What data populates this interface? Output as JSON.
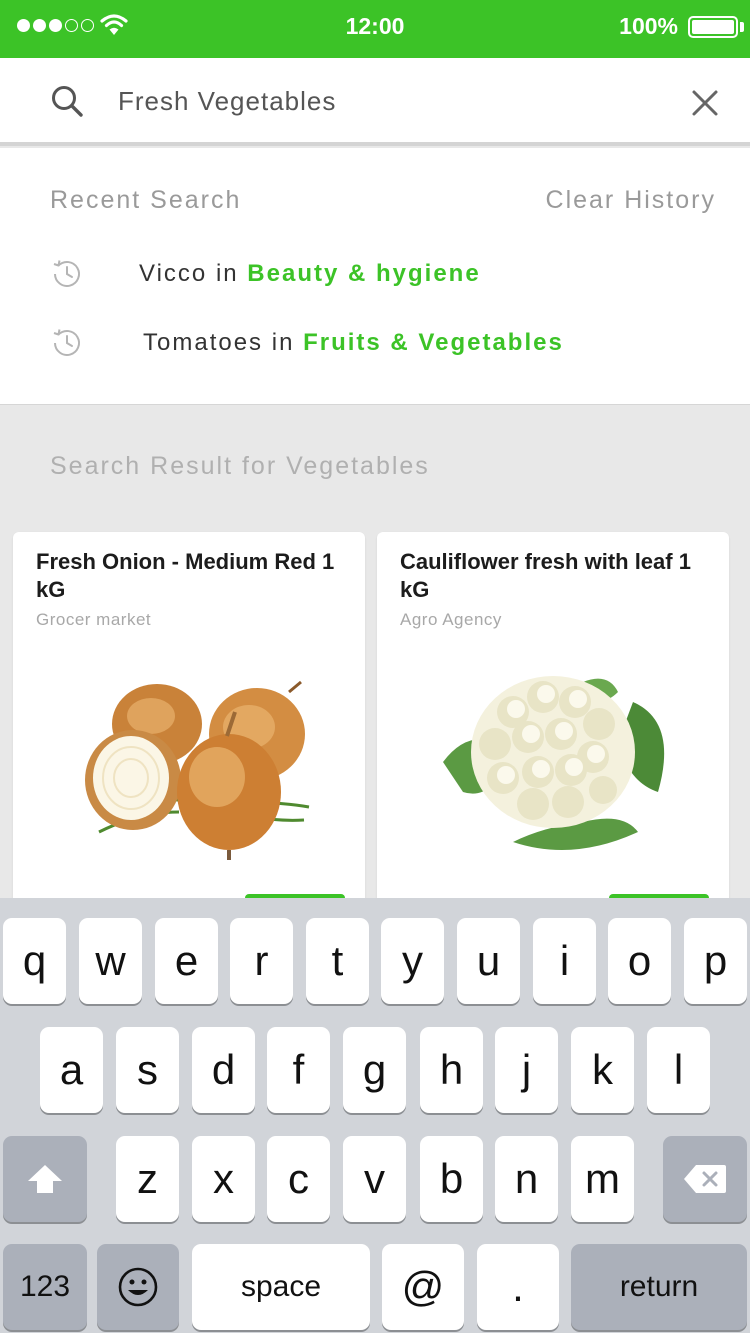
{
  "status_bar": {
    "time": "12:00",
    "battery": "100%",
    "signal_bars_filled": 3,
    "signal_bars_total": 5
  },
  "search": {
    "value": "Fresh Vegetables",
    "placeholder": ""
  },
  "recent": {
    "title": "Recent Search",
    "clear_label": "Clear History",
    "items": [
      {
        "term": "Vicco",
        "joiner": "in",
        "category": "Beauty & hygiene"
      },
      {
        "term": "Tomatoes",
        "joiner": "in",
        "category": "Fruits & Vegetables"
      }
    ]
  },
  "results": {
    "title": "Search Result for Vegetables",
    "products": [
      {
        "name": "Fresh Onion - Medium Red  1 kG",
        "seller": "Grocer market",
        "image_icon": "onion-image"
      },
      {
        "name": "Cauliflower fresh  with leaf 1 kG",
        "seller": "Agro Agency",
        "image_icon": "cauliflower-image"
      }
    ]
  },
  "keyboard": {
    "row1": [
      "q",
      "w",
      "e",
      "r",
      "t",
      "y",
      "u",
      "i",
      "o",
      "p"
    ],
    "row2": [
      "a",
      "s",
      "d",
      "f",
      "g",
      "h",
      "j",
      "k",
      "l"
    ],
    "row3": [
      "z",
      "x",
      "c",
      "v",
      "b",
      "n",
      "m"
    ],
    "numbers_label": "123",
    "space_label": "space",
    "at_label": "@",
    "period_label": ".",
    "return_label": "return",
    "emoji_icon": "emoji-icon",
    "shift_icon": "shift-icon",
    "backspace_icon": "backspace-icon"
  },
  "colors": {
    "accent": "#3cc327",
    "background": "#e8e8e8",
    "keyboard": "#d1d4d9"
  }
}
